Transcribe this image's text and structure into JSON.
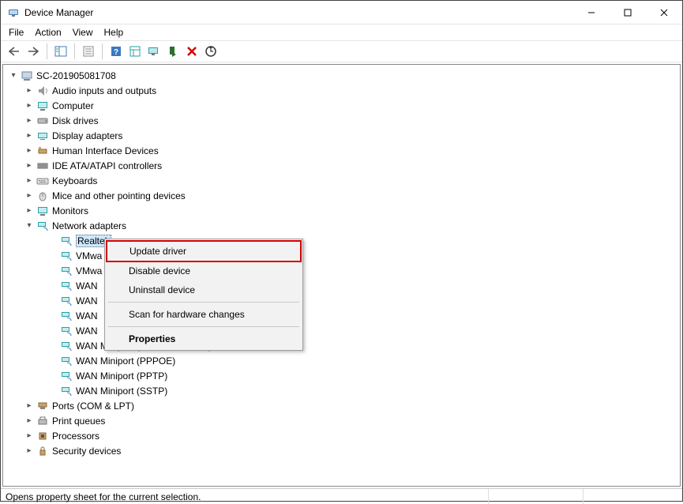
{
  "window": {
    "title": "Device Manager"
  },
  "menu": {
    "file": "File",
    "action": "Action",
    "view": "View",
    "help": "Help"
  },
  "toolbar": {
    "back": "back-icon",
    "forward": "forward-icon",
    "show_hide": "show-hide-tree-icon",
    "properties": "properties-icon",
    "help": "help-icon",
    "details": "details-icon",
    "monitor": "update-driver-icon",
    "install": "install-icon",
    "delete": "delete-icon",
    "scan": "scan-hardware-icon"
  },
  "tree": {
    "root": "SC-201905081708",
    "cat": {
      "audio": "Audio inputs and outputs",
      "computer": "Computer",
      "disk": "Disk drives",
      "display": "Display adapters",
      "hid": "Human Interface Devices",
      "ide": "IDE ATA/ATAPI controllers",
      "keyboards": "Keyboards",
      "mice": "Mice and other pointing devices",
      "monitors": "Monitors",
      "network": "Network adapters",
      "ports": "Ports (COM & LPT)",
      "printq": "Print queues",
      "processors": "Processors",
      "security": "Security devices"
    },
    "net": {
      "realtek": "Realtek",
      "vmwa1": "VMwa",
      "vmwa2": "VMwa",
      "wan1": "WAN",
      "wan2": "WAN",
      "wan3": "WAN",
      "wan4": "WAN",
      "wan5_full": "WAN Miniport (Network Monitor)",
      "wan6": "WAN Miniport (PPPOE)",
      "wan7": "WAN Miniport (PPTP)",
      "wan8": "WAN Miniport (SSTP)"
    }
  },
  "context_menu": {
    "update": "Update driver",
    "disable": "Disable device",
    "uninstall": "Uninstall device",
    "scan": "Scan for hardware changes",
    "properties": "Properties"
  },
  "status": {
    "message": "Opens property sheet for the current selection."
  }
}
